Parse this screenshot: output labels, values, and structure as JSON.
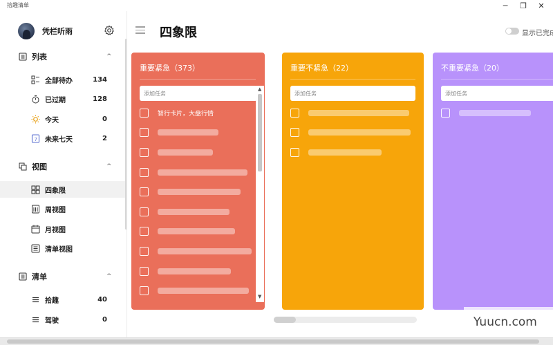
{
  "window": {
    "title": "拾趣清单",
    "min": "─",
    "max": "❐",
    "close": "✕"
  },
  "user": {
    "name": "凭栏听雨"
  },
  "sidebar": {
    "list_section": {
      "label": "列表",
      "caret": "^"
    },
    "list_items": [
      {
        "label": "全部待办",
        "count": "134",
        "icon": "grid-list-icon"
      },
      {
        "label": "已过期",
        "count": "128",
        "icon": "stopwatch-icon"
      },
      {
        "label": "今天",
        "count": "0",
        "icon": "sun-icon"
      },
      {
        "label": "未来七天",
        "count": "2",
        "icon": "calendar-7-icon"
      }
    ],
    "view_section": {
      "label": "视图",
      "caret": "^"
    },
    "view_items": [
      {
        "label": "四象限",
        "icon": "quadrant-icon",
        "active": true
      },
      {
        "label": "周视图",
        "icon": "week-view-icon"
      },
      {
        "label": "月视图",
        "icon": "calendar-icon"
      },
      {
        "label": "清单视图",
        "icon": "list-view-icon"
      }
    ],
    "checklist_section": {
      "label": "清单",
      "caret": "^"
    },
    "checklist_items": [
      {
        "label": "拾趣",
        "count": "40",
        "icon": "menu-lines-icon"
      },
      {
        "label": "驾驶",
        "count": "0",
        "icon": "menu-lines-icon"
      }
    ]
  },
  "main": {
    "title": "四象限",
    "toggle_label": "显示已完成",
    "quadrants": [
      {
        "title": "重要紧急（373）",
        "color": "#ea6f5a",
        "placeholder": "添加任务",
        "first_task": "智行卡片，大盘行情"
      },
      {
        "title": "重要不紧急（22）",
        "color": "#f7a50a",
        "placeholder": "添加任务"
      },
      {
        "title": "不重要紧急（20）",
        "color": "#b892fb",
        "placeholder": "添加任务"
      }
    ]
  },
  "watermark": "Yuucn.com"
}
